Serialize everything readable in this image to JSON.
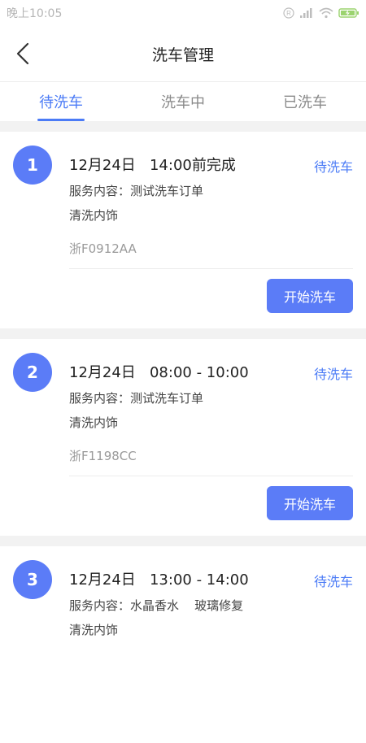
{
  "status_bar": {
    "time": "晚上10:05"
  },
  "nav": {
    "title": "洗车管理"
  },
  "tabs": [
    {
      "label": "待洗车",
      "active": true
    },
    {
      "label": "洗车中",
      "active": false
    },
    {
      "label": "已洗车",
      "active": false
    }
  ],
  "orders": [
    {
      "index": "1",
      "when": "12月24日   14:00前完成",
      "status": "待洗车",
      "service": "服务内容：测试洗车订单",
      "extra": "清洗内饰",
      "plate": "浙F0912AA",
      "action": "开始洗车"
    },
    {
      "index": "2",
      "when": "12月24日   08:00 - 10:00",
      "status": "待洗车",
      "service": "服务内容：测试洗车订单",
      "extra": "清洗内饰",
      "plate": "浙F1198CC",
      "action": "开始洗车"
    },
    {
      "index": "3",
      "when": "12月24日   13:00 - 14:00",
      "status": "待洗车",
      "service": "服务内容：水晶香水    玻璃修复",
      "extra": "清洗内饰",
      "plate": "",
      "action": ""
    }
  ],
  "colors": {
    "accent": "#4b7bf6",
    "badge": "#5b7cf7",
    "background": "#f2f2f2"
  }
}
